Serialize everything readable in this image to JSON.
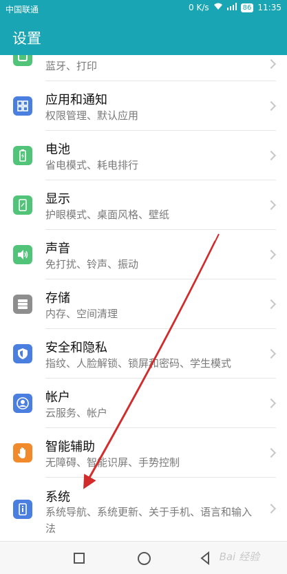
{
  "status": {
    "carrier": "中国联通",
    "speed": "0 K/s",
    "battery": "86",
    "time": "11:35"
  },
  "app": {
    "title": "设置"
  },
  "items": [
    {
      "title": "",
      "subtitle": "蓝牙、打印",
      "icon": "device-connectivity-icon",
      "color": "#52c47a"
    },
    {
      "title": "应用和通知",
      "subtitle": "权限管理、默认应用",
      "icon": "apps-grid-icon",
      "color": "#4a7fe0"
    },
    {
      "title": "电池",
      "subtitle": "省电模式、耗电排行",
      "icon": "battery-icon",
      "color": "#52c47a"
    },
    {
      "title": "显示",
      "subtitle": "护眼模式、桌面风格、壁纸",
      "icon": "display-icon",
      "color": "#52c47a"
    },
    {
      "title": "声音",
      "subtitle": "免打扰、铃声、振动",
      "icon": "sound-icon",
      "color": "#52c47a"
    },
    {
      "title": "存储",
      "subtitle": "内存、空间清理",
      "icon": "storage-icon",
      "color": "#8e8e8e"
    },
    {
      "title": "安全和隐私",
      "subtitle": "指纹、人脸解锁、锁屏和密码、学生模式",
      "icon": "shield-icon",
      "color": "#4a7fe0"
    },
    {
      "title": "帐户",
      "subtitle": "云服务、帐户",
      "icon": "account-icon",
      "color": "#4a7fe0"
    },
    {
      "title": "智能辅助",
      "subtitle": "无障碍、智能识屏、手势控制",
      "icon": "hand-icon",
      "color": "#f08a2a"
    },
    {
      "title": "系统",
      "subtitle": "系统导航、系统更新、关于手机、语言和输入法",
      "icon": "system-info-icon",
      "color": "#4a7fe0"
    }
  ],
  "watermark": "Bai 经验"
}
